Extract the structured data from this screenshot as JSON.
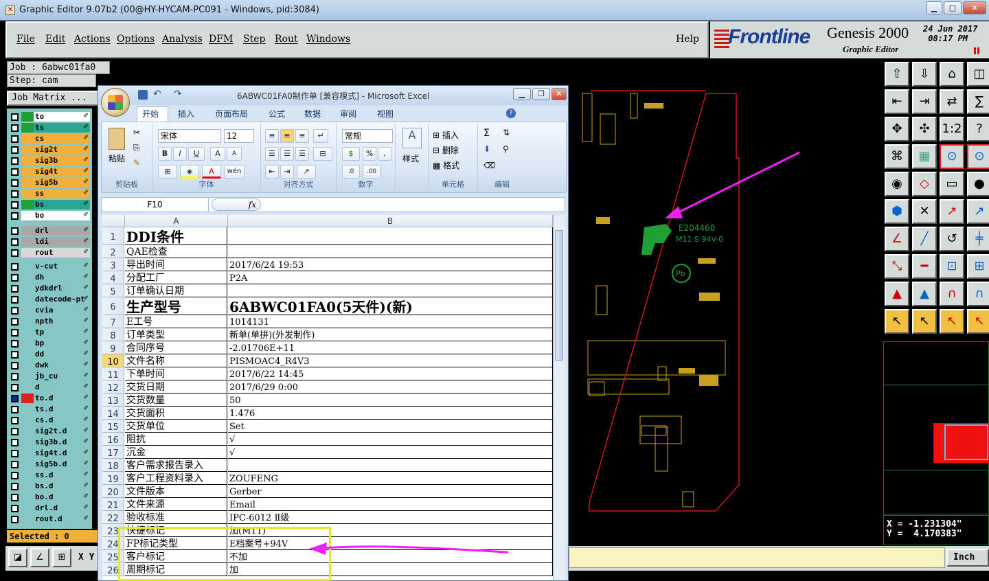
{
  "window": {
    "title": "Graphic Editor 9.07b2 (00@HY-HYCAM-PC091 - Windows, pid:3084)",
    "min": "▁",
    "max": "□",
    "close": "✕"
  },
  "menu": {
    "items": [
      "File",
      "Edit",
      "Actions",
      "Options",
      "Analysis",
      "DFM",
      "Step",
      "Rout",
      "Windows"
    ],
    "help": "Help"
  },
  "logo": {
    "brand": "Frontline",
    "product": "Genesis 2000",
    "subtitle": "Graphic Editor",
    "date": "24 Jun 2017\n 08:17 PM"
  },
  "job": {
    "job_line": "Job : 6abwc01fa0",
    "step_line": "Step: cam",
    "matrix_label": "Job Matrix ..."
  },
  "layers": [
    {
      "name": "to",
      "color": "#1ea034",
      "bg": "#ffffff"
    },
    {
      "name": "ts",
      "color": "#1ea034",
      "bg": "#28a890"
    },
    {
      "name": "cs",
      "color": "#f0b03a",
      "bg": "#f0b03a"
    },
    {
      "name": "sig2t",
      "color": "#f0b03a",
      "bg": "#f0b03a"
    },
    {
      "name": "sig3b",
      "color": "#f0b03a",
      "bg": "#f0b03a"
    },
    {
      "name": "sig4t",
      "color": "#f0b03a",
      "bg": "#f0b03a"
    },
    {
      "name": "sig5b",
      "color": "#f0b03a",
      "bg": "#f0b03a"
    },
    {
      "name": "ss",
      "color": "#f0b03a",
      "bg": "#f0b03a"
    },
    {
      "name": "bs",
      "color": "#1ea034",
      "bg": "#28a890"
    },
    {
      "name": "bo",
      "color": "#ffffff",
      "bg": "#ffffff"
    },
    {
      "name": "drl",
      "color": "#a8a8a8",
      "bg": "#a8a8a8"
    },
    {
      "name": "ldi",
      "color": "#a8a8a8",
      "bg": "#a8a8a8"
    },
    {
      "name": "rout",
      "color": "#d8d8d8",
      "bg": "#d8d8d8"
    },
    {
      "name": "v-cut",
      "color": "#87c7c3",
      "bg": "#87c7c3"
    },
    {
      "name": "dh",
      "color": "#87c7c3",
      "bg": "#87c7c3"
    },
    {
      "name": "ydkdrl",
      "color": "#87c7c3",
      "bg": "#87c7c3"
    },
    {
      "name": "datecode-pt",
      "color": "#87c7c3",
      "bg": "#87c7c3"
    },
    {
      "name": "cvia",
      "color": "#87c7c3",
      "bg": "#87c7c3"
    },
    {
      "name": "npth",
      "color": "#87c7c3",
      "bg": "#87c7c3"
    },
    {
      "name": "tp",
      "color": "#87c7c3",
      "bg": "#87c7c3"
    },
    {
      "name": "bp",
      "color": "#87c7c3",
      "bg": "#87c7c3"
    },
    {
      "name": "dd",
      "color": "#87c7c3",
      "bg": "#87c7c3"
    },
    {
      "name": "dwk",
      "color": "#87c7c3",
      "bg": "#87c7c3"
    },
    {
      "name": "jb_cu",
      "color": "#87c7c3",
      "bg": "#87c7c3"
    },
    {
      "name": "d",
      "color": "#87c7c3",
      "bg": "#87c7c3"
    },
    {
      "name": "to.d",
      "color": "#e02020",
      "bg": "#87c7c3"
    },
    {
      "name": "ts.d",
      "color": "#87c7c3",
      "bg": "#87c7c3"
    },
    {
      "name": "cs.d",
      "color": "#87c7c3",
      "bg": "#87c7c3"
    },
    {
      "name": "sig2t.d",
      "color": "#87c7c3",
      "bg": "#87c7c3"
    },
    {
      "name": "sig3b.d",
      "color": "#87c7c3",
      "bg": "#87c7c3"
    },
    {
      "name": "sig4t.d",
      "color": "#87c7c3",
      "bg": "#87c7c3"
    },
    {
      "name": "sig5b.d",
      "color": "#87c7c3",
      "bg": "#87c7c3"
    },
    {
      "name": "ss.d",
      "color": "#87c7c3",
      "bg": "#87c7c3"
    },
    {
      "name": "bs.d",
      "color": "#87c7c3",
      "bg": "#87c7c3"
    },
    {
      "name": "bo.d",
      "color": "#87c7c3",
      "bg": "#87c7c3"
    },
    {
      "name": "drl.d",
      "color": "#87c7c3",
      "bg": "#87c7c3"
    },
    {
      "name": "rout.d",
      "color": "#87c7c3",
      "bg": "#87c7c3"
    }
  ],
  "status": {
    "selected": "Selected : 0",
    "xy_label": "X Y :",
    "unit": "Inch",
    "coords": "X = -1.231304\"\nY =  4.170383\""
  },
  "canvas_text": {
    "ul_number": "E204460",
    "ul_code": "M11 S 94V-0",
    "pb": "Pb"
  },
  "excel": {
    "title": "6ABWC01FA0制作单 [兼容模式] - Microsoft Excel",
    "tabs": [
      "开始",
      "插入",
      "页面布局",
      "公式",
      "数据",
      "审阅",
      "视图"
    ],
    "ribbon": {
      "paste": "粘贴",
      "clipboard": "剪贴板",
      "font_name": "宋体",
      "font_size": "12",
      "font": "字体",
      "alignment": "对齐方式",
      "num_format": "常规",
      "number": "数字",
      "styles": "样式",
      "insert": "插入",
      "delete": "删除",
      "format": "格式",
      "cells": "单元格",
      "editing": "编辑"
    },
    "name_box": "F10",
    "fx": "fx",
    "columns": [
      "A",
      "B"
    ],
    "rows": [
      {
        "n": "1",
        "a": "DDI条件",
        "b": "",
        "big": true
      },
      {
        "n": "2",
        "a": "QAE检查",
        "b": ""
      },
      {
        "n": "3",
        "a": "导出时间",
        "b": "2017/6/24 19:53"
      },
      {
        "n": "4",
        "a": "分配工厂",
        "b": "P2A"
      },
      {
        "n": "5",
        "a": "订单确认日期",
        "b": ""
      },
      {
        "n": "6",
        "a": "生产型号",
        "b": "6ABWC01FA0(5天件)(新)",
        "big": true
      },
      {
        "n": "7",
        "a": "E工号",
        "b": "1014131"
      },
      {
        "n": "8",
        "a": "订单类型",
        "b": "新单(单拼)(外发制作)"
      },
      {
        "n": "9",
        "a": "合同序号",
        "b": "-2.01706E+11"
      },
      {
        "n": "10",
        "a": "文件名称",
        "b": "PISMOAC4_R4V3",
        "sel": true
      },
      {
        "n": "11",
        "a": "下单时间",
        "b": "2017/6/22 14:45"
      },
      {
        "n": "12",
        "a": "交货日期",
        "b": "2017/6/29 0:00"
      },
      {
        "n": "13",
        "a": "交货数量",
        "b": "50"
      },
      {
        "n": "14",
        "a": "交货面积",
        "b": "1.476"
      },
      {
        "n": "15",
        "a": "交货单位",
        "b": "Set"
      },
      {
        "n": "16",
        "a": "阻抗",
        "b": "√"
      },
      {
        "n": "17",
        "a": "沉金",
        "b": "√"
      },
      {
        "n": "18",
        "a": "客户需求报告录入",
        "b": ""
      },
      {
        "n": "19",
        "a": "客户工程资料录入",
        "b": "ZOUFENG"
      },
      {
        "n": "20",
        "a": "文件版本",
        "b": "Gerber"
      },
      {
        "n": "21",
        "a": "文件来源",
        "b": "Email"
      },
      {
        "n": "22",
        "a": "验收标准",
        "b": "IPC-6012 Ⅱ级"
      },
      {
        "n": "23",
        "a": "快捷标记",
        "b": "加(M11)"
      },
      {
        "n": "24",
        "a": "FP标记类型",
        "b": "E档案号+94V"
      },
      {
        "n": "25",
        "a": "客户标记",
        "b": "不加"
      },
      {
        "n": "26",
        "a": "周期标记",
        "b": "加"
      }
    ]
  }
}
